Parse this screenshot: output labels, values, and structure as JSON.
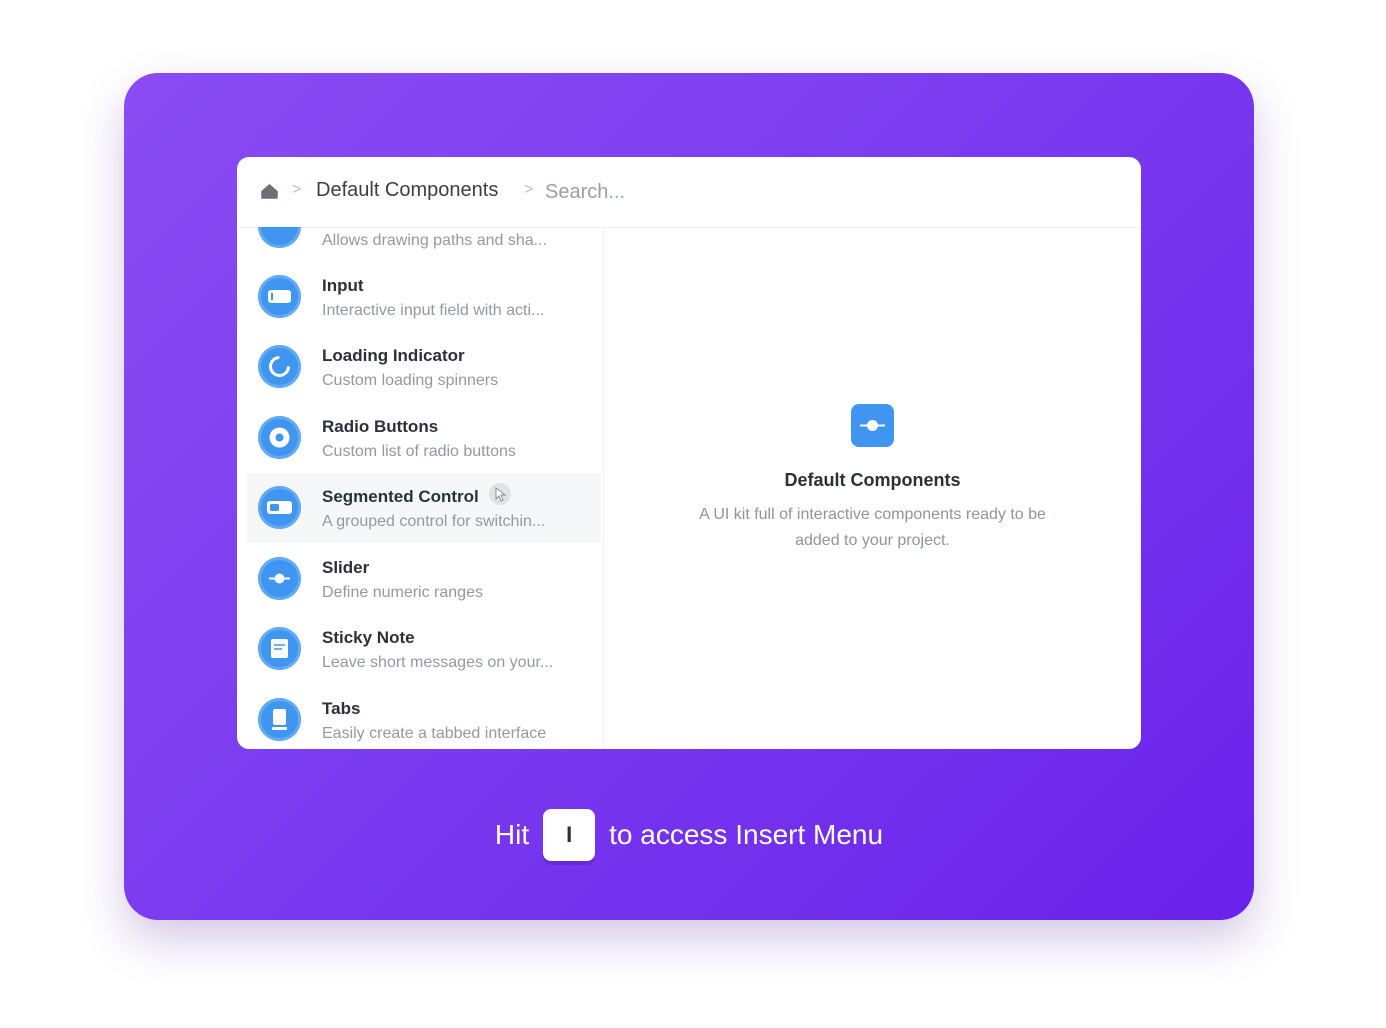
{
  "breadcrumb": {
    "home_icon": "home-icon",
    "separator": ">",
    "title": "Default Components"
  },
  "search": {
    "placeholder": "Search..."
  },
  "components": [
    {
      "name": "",
      "description": "Allows drawing paths and sha...",
      "icon": "pen-icon"
    },
    {
      "name": "Input",
      "description": "Interactive input field with acti...",
      "icon": "input-icon"
    },
    {
      "name": "Loading Indicator",
      "description": "Custom loading spinners",
      "icon": "spinner-icon"
    },
    {
      "name": "Radio Buttons",
      "description": "Custom list of radio buttons",
      "icon": "radio-icon"
    },
    {
      "name": "Segmented Control",
      "description": "A grouped control for switchin...",
      "icon": "segmented-control-icon"
    },
    {
      "name": "Slider",
      "description": "Define numeric ranges",
      "icon": "slider-icon"
    },
    {
      "name": "Sticky Note",
      "description": "Leave short messages on your...",
      "icon": "sticky-note-icon"
    },
    {
      "name": "Tabs",
      "description": "Easily create a tabbed interface",
      "icon": "tabs-icon"
    }
  ],
  "detail": {
    "icon": "slider-icon",
    "title": "Default Components",
    "description": "A UI kit full of interactive components ready to be added to your project."
  },
  "hint": {
    "prefix": "Hit",
    "key": "I",
    "suffix": "to access Insert Menu"
  },
  "colors": {
    "accent": "#3f95ef",
    "background_gradient_start": "#8a4cf2",
    "background_gradient_end": "#6a22ea"
  }
}
